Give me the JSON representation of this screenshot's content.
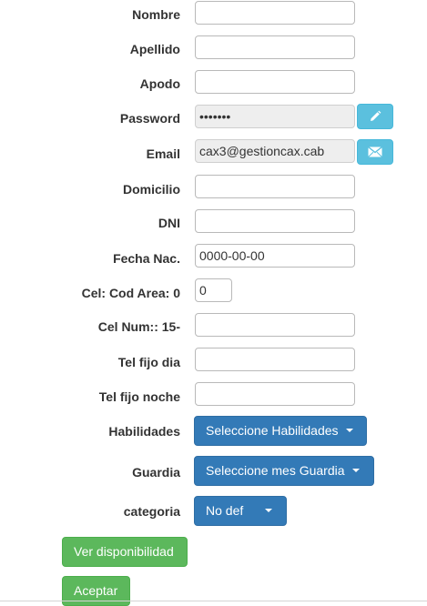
{
  "form": {
    "nombre": {
      "label": "Nombre",
      "value": ""
    },
    "apellido": {
      "label": "Apellido",
      "value": ""
    },
    "apodo": {
      "label": "Apodo",
      "value": ""
    },
    "password": {
      "label": "Password",
      "value": "•••••••"
    },
    "email": {
      "label": "Email",
      "value": "cax3@gestioncax.cab"
    },
    "domicilio": {
      "label": "Domicilio",
      "value": ""
    },
    "dni": {
      "label": "DNI",
      "value": ""
    },
    "fecha_nac": {
      "label": "Fecha Nac.",
      "value": "0000-00-00"
    },
    "cod_area": {
      "label": "Cel: Cod Area: 0",
      "value": "0"
    },
    "cel_num": {
      "label": "Cel Num:: 15-",
      "value": ""
    },
    "tel_dia": {
      "label": "Tel fijo dia",
      "value": ""
    },
    "tel_noche": {
      "label": "Tel fijo noche",
      "value": ""
    },
    "habilidades": {
      "label": "Habilidades",
      "button": "Seleccione Habilidades"
    },
    "guardia": {
      "label": "Guardia",
      "button": "Seleccione mes Guardia"
    },
    "categoria": {
      "label": "categoria",
      "button": "No def"
    }
  },
  "actions": {
    "ver_disponibilidad": "Ver disponibilidad",
    "aceptar": "Aceptar"
  },
  "icons": {
    "edit": "pencil-icon",
    "email": "envelope-icon"
  },
  "colors": {
    "primary": "#337ab7",
    "info": "#5bc0de",
    "success": "#5cb85c",
    "disabled_bg": "#eeeeee"
  }
}
